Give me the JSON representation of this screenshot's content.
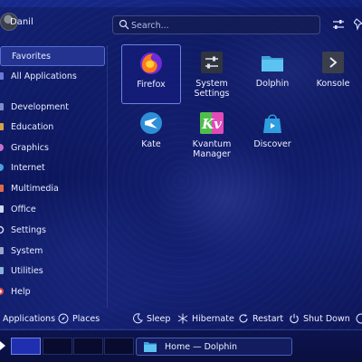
{
  "user": {
    "name": "Danil"
  },
  "search": {
    "placeholder": "Search..."
  },
  "sidebar": {
    "items": [
      {
        "label": "Favorites",
        "active": true
      },
      {
        "label": "All Applications"
      },
      {
        "label": "Development"
      },
      {
        "label": "Education"
      },
      {
        "label": "Graphics"
      },
      {
        "label": "Internet"
      },
      {
        "label": "Multimedia"
      },
      {
        "label": "Office"
      },
      {
        "label": "Settings"
      },
      {
        "label": "System"
      },
      {
        "label": "Utilities"
      },
      {
        "label": "Help"
      }
    ]
  },
  "apps": [
    {
      "label": "Firefox",
      "icon": "firefox-icon",
      "selected": true
    },
    {
      "label": "System\nSettings",
      "icon": "system-settings-icon"
    },
    {
      "label": "Dolphin",
      "icon": "dolphin-folder-icon"
    },
    {
      "label": "Konsole",
      "icon": "konsole-icon"
    },
    {
      "label": "Kate",
      "icon": "kate-icon"
    },
    {
      "label": "Kvantum\nManager",
      "icon": "kvantum-icon"
    },
    {
      "label": "Discover",
      "icon": "discover-icon"
    }
  ],
  "footer": {
    "applications": "Applications",
    "places": "Places",
    "sleep": "Sleep",
    "hibernate": "Hibernate",
    "restart": "Restart",
    "shutdown": "Shut Down"
  },
  "taskbar": {
    "task_label": "Home — Dolphin"
  },
  "colors": {
    "accent": "#2a3fc0",
    "panel": "#0c1450",
    "wallpaper": "#172a8c"
  }
}
